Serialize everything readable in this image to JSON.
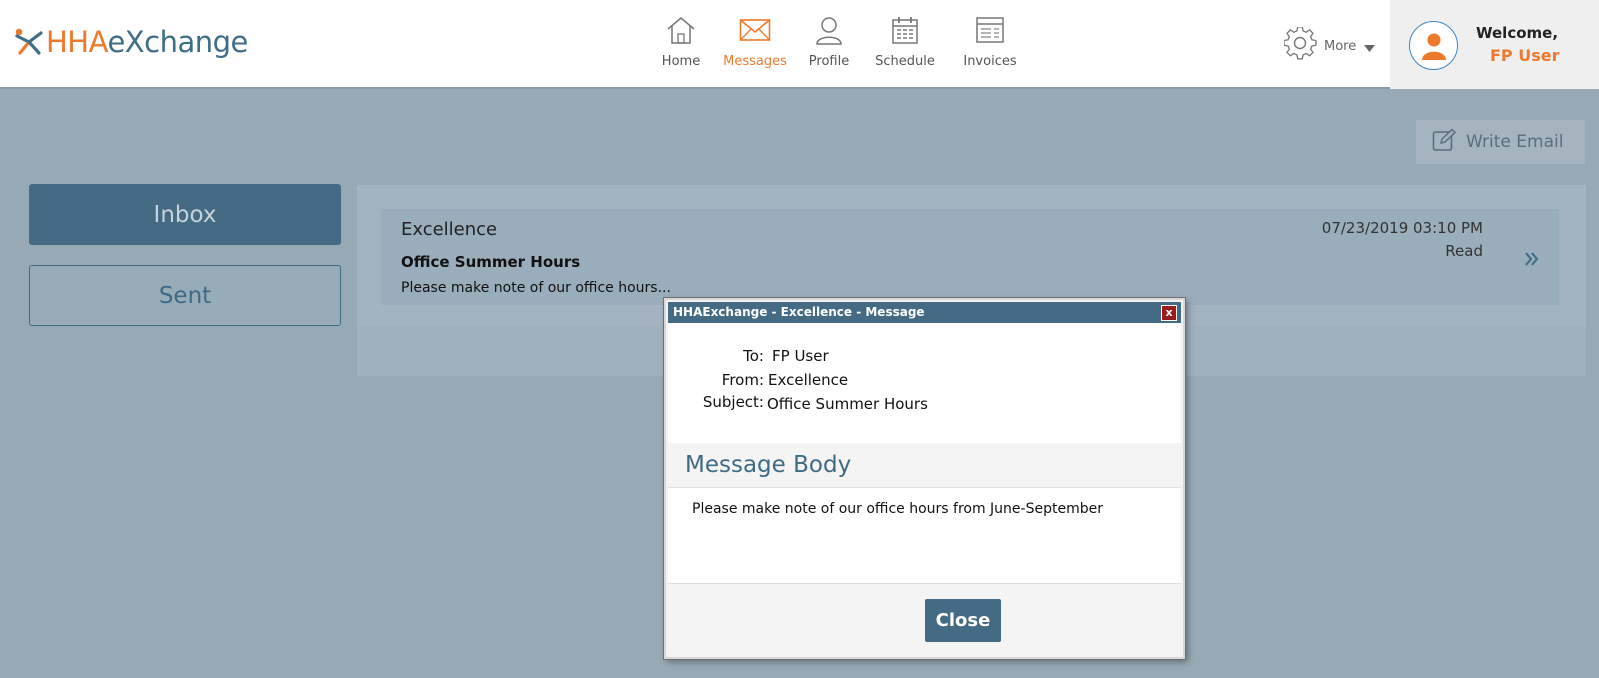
{
  "brand": {
    "part1": "HHA",
    "part2": "eXchange"
  },
  "nav": [
    {
      "label": "Home",
      "icon": "home-icon"
    },
    {
      "label": "Messages",
      "icon": "envelope-icon",
      "active": true
    },
    {
      "label": "Profile",
      "icon": "user-icon"
    },
    {
      "label": "Schedule",
      "icon": "calendar-icon"
    },
    {
      "label": "Invoices",
      "icon": "invoice-icon"
    }
  ],
  "more": {
    "label": "More"
  },
  "welcome": {
    "greeting": "Welcome,",
    "user": "FP User"
  },
  "write_email": {
    "label": "Write Email"
  },
  "sidebar": {
    "inbox": "Inbox",
    "sent": "Sent"
  },
  "messages": [
    {
      "from": "Excellence",
      "subject": "Office Summer Hours",
      "preview": "Please make note of our office hours...",
      "date": "07/23/2019 03:10 PM",
      "status": "Read"
    }
  ],
  "dialog": {
    "title": "HHAExchange - Excellence - Message",
    "close_x": "x",
    "to_label": "To:",
    "to": "FP User",
    "from_label": "From:",
    "from": "Excellence",
    "subject_label": "Subject:",
    "subject": "Office Summer Hours",
    "body_title": "Message Body",
    "body": "Please make note of our office hours from June-September",
    "close_button": "Close"
  },
  "colors": {
    "accent_orange": "#ed7a2c",
    "primary_blue": "#446b83",
    "overlay_bg": "#96a9b5"
  }
}
